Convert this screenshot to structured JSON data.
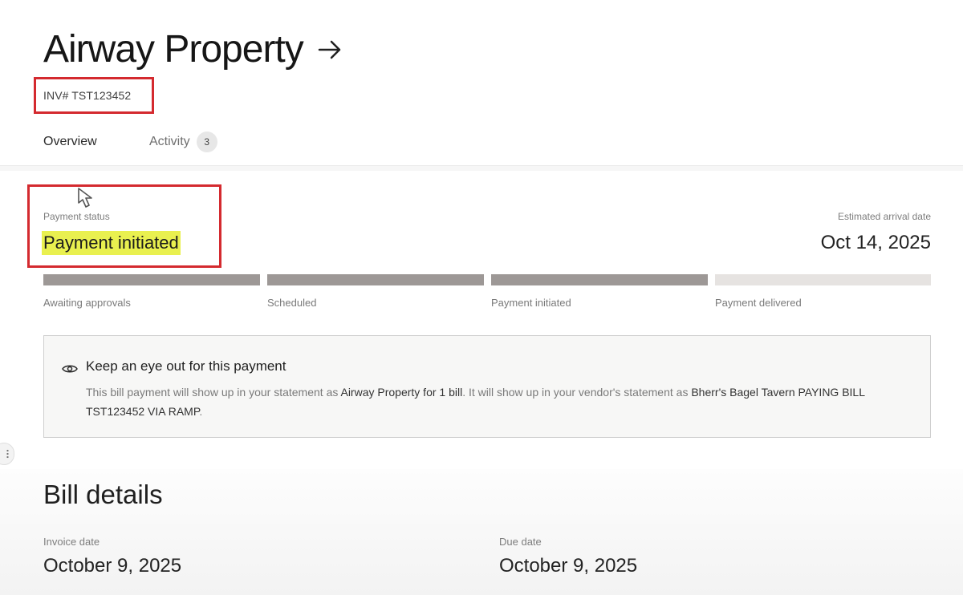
{
  "header": {
    "title": "Airway Property",
    "invoice_number": "INV# TST123452"
  },
  "tabs": [
    {
      "label": "Overview",
      "active": true
    },
    {
      "label": "Activity",
      "badge": "3"
    }
  ],
  "status": {
    "label": "Payment status",
    "value": "Payment initiated",
    "eta_label": "Estimated arrival date",
    "eta_value": "Oct 14, 2025"
  },
  "progress": {
    "steps": [
      {
        "label": "Awaiting approvals",
        "done": true
      },
      {
        "label": "Scheduled",
        "done": true
      },
      {
        "label": "Payment initiated",
        "done": true
      },
      {
        "label": "Payment delivered",
        "done": false
      }
    ]
  },
  "notice": {
    "title": "Keep an eye out for this payment",
    "text_1": "This bill payment will show up in your statement as ",
    "strong_1": "Airway Property for 1 bill",
    "text_2": ". It will show up in your vendor's statement as ",
    "strong_2": "Bherr's Bagel Tavern PAYING BILL TST123452 VIA RAMP",
    "text_3": "."
  },
  "bill_details": {
    "title": "Bill details",
    "invoice_date_label": "Invoice date",
    "invoice_date_value": "October 9, 2025",
    "due_date_label": "Due date",
    "due_date_value": "October 9, 2025"
  },
  "colors": {
    "annotation_box": "#d42a2f",
    "highlight": "#e9f04f",
    "progress_done": "#9d9896",
    "progress_todo": "#e6e3e1"
  },
  "icons": [
    "right-arrow-icon",
    "mouse-pointer-icon",
    "eye-icon",
    "drag-handle-icon"
  ]
}
